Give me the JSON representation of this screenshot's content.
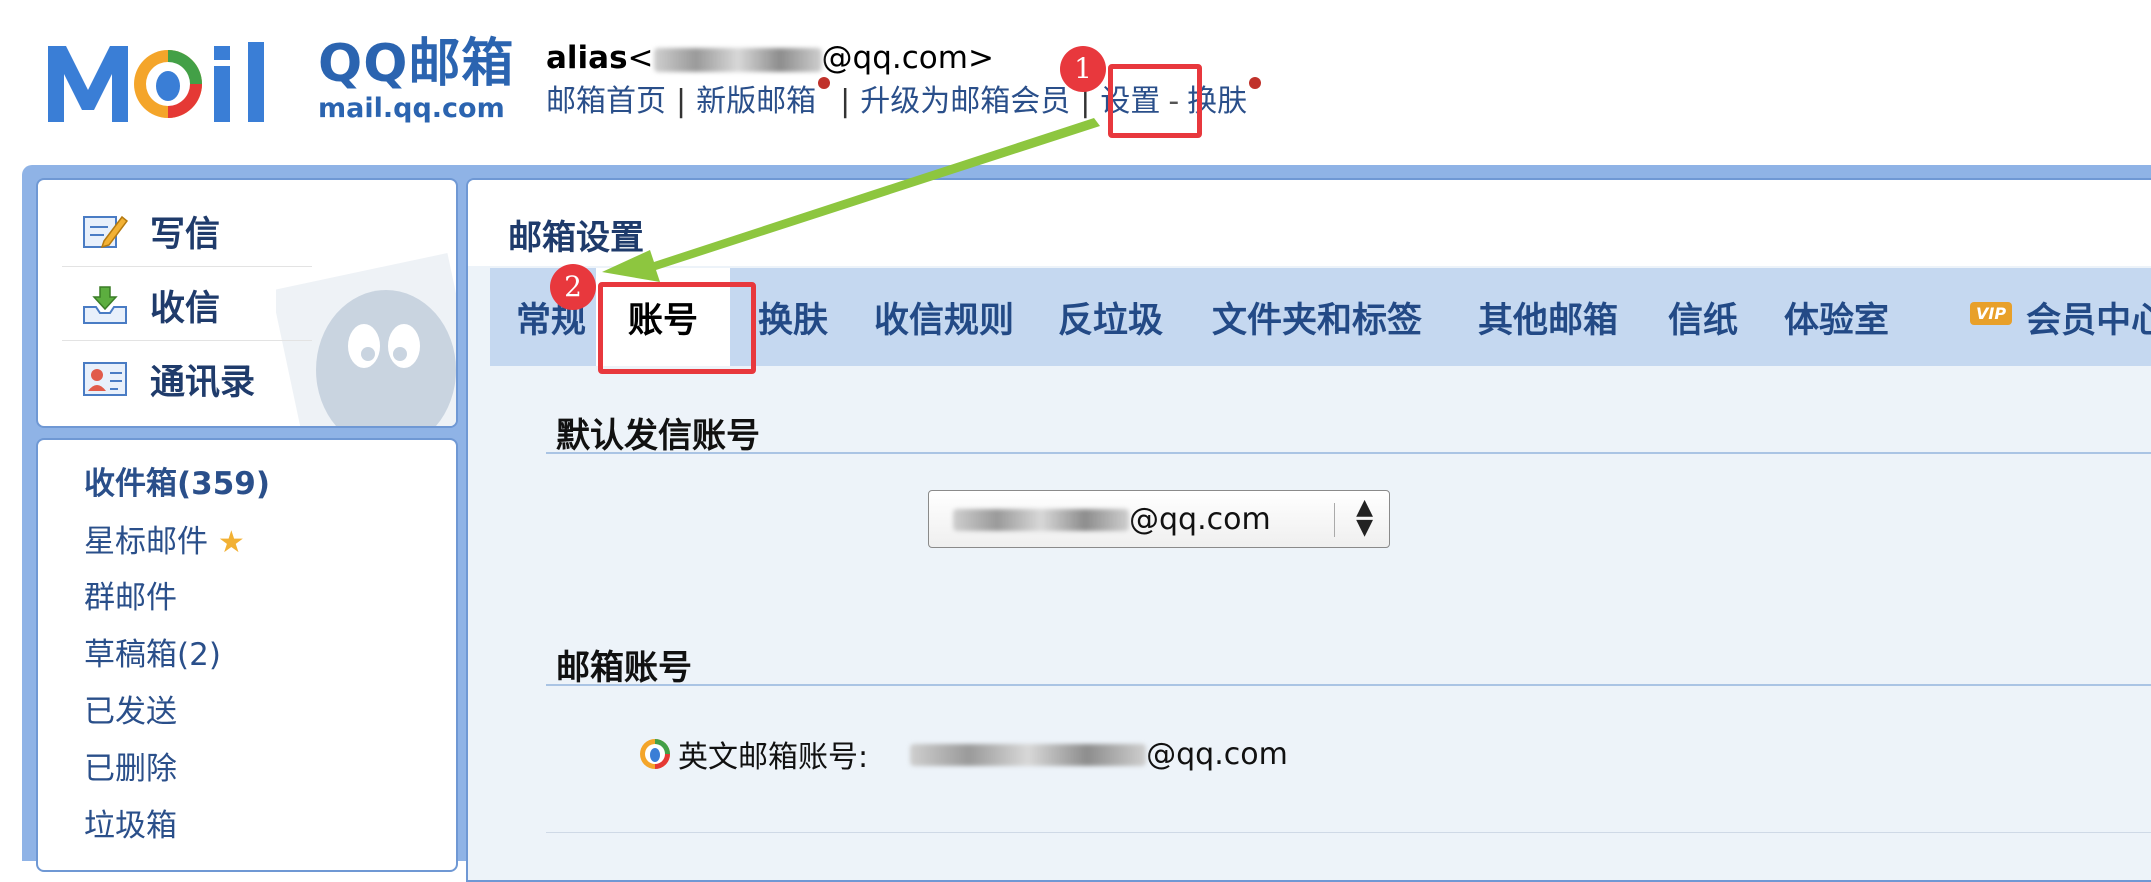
{
  "brand": {
    "name_cn": "QQ邮箱",
    "url": "mail.qq.com",
    "logo_colors": [
      "#3a7ed6",
      "#f4a52a",
      "#43a047",
      "#e53935"
    ]
  },
  "user": {
    "alias_label": "alias",
    "email_suffix": "@qq.com>",
    "open_bracket": "<"
  },
  "top_nav": {
    "home": "邮箱首页",
    "new_version": "新版邮箱",
    "upgrade": "升级为邮箱会员",
    "settings": "设置",
    "dash": "-",
    "skin": "换肤",
    "separator": "|"
  },
  "annotations": {
    "step1": "1",
    "step2": "2",
    "marker_color": "#e8383d",
    "arrow_color": "#8dc63f"
  },
  "quick_actions": [
    {
      "label": "写信",
      "icon": "compose-icon"
    },
    {
      "label": "收信",
      "icon": "receive-icon"
    },
    {
      "label": "通讯录",
      "icon": "contacts-icon"
    }
  ],
  "folders": [
    {
      "label": "收件箱(359)",
      "name": "inbox"
    },
    {
      "label": "星标邮件",
      "name": "starred"
    },
    {
      "label": "群邮件",
      "name": "group-mail"
    },
    {
      "label": "草稿箱(2)",
      "name": "drafts"
    },
    {
      "label": "已发送",
      "name": "sent"
    },
    {
      "label": "已删除",
      "name": "deleted"
    },
    {
      "label": "垃圾箱",
      "name": "spam"
    }
  ],
  "settings": {
    "title": "邮箱设置",
    "tabs": [
      {
        "label": "常规"
      },
      {
        "label": "账号",
        "active": true
      },
      {
        "label": "换肤"
      },
      {
        "label": "收信规则"
      },
      {
        "label": "反垃圾"
      },
      {
        "label": "文件夹和标签"
      },
      {
        "label": "其他邮箱"
      },
      {
        "label": "信纸"
      },
      {
        "label": "体验室"
      },
      {
        "label": "会员中心"
      }
    ],
    "vip_badge": "VIP"
  },
  "default_sender": {
    "title": "默认发信账号",
    "selected_suffix": "@qq.com"
  },
  "mail_account": {
    "title": "邮箱账号",
    "label": "英文邮箱账号:",
    "value_suffix": "@qq.com"
  }
}
